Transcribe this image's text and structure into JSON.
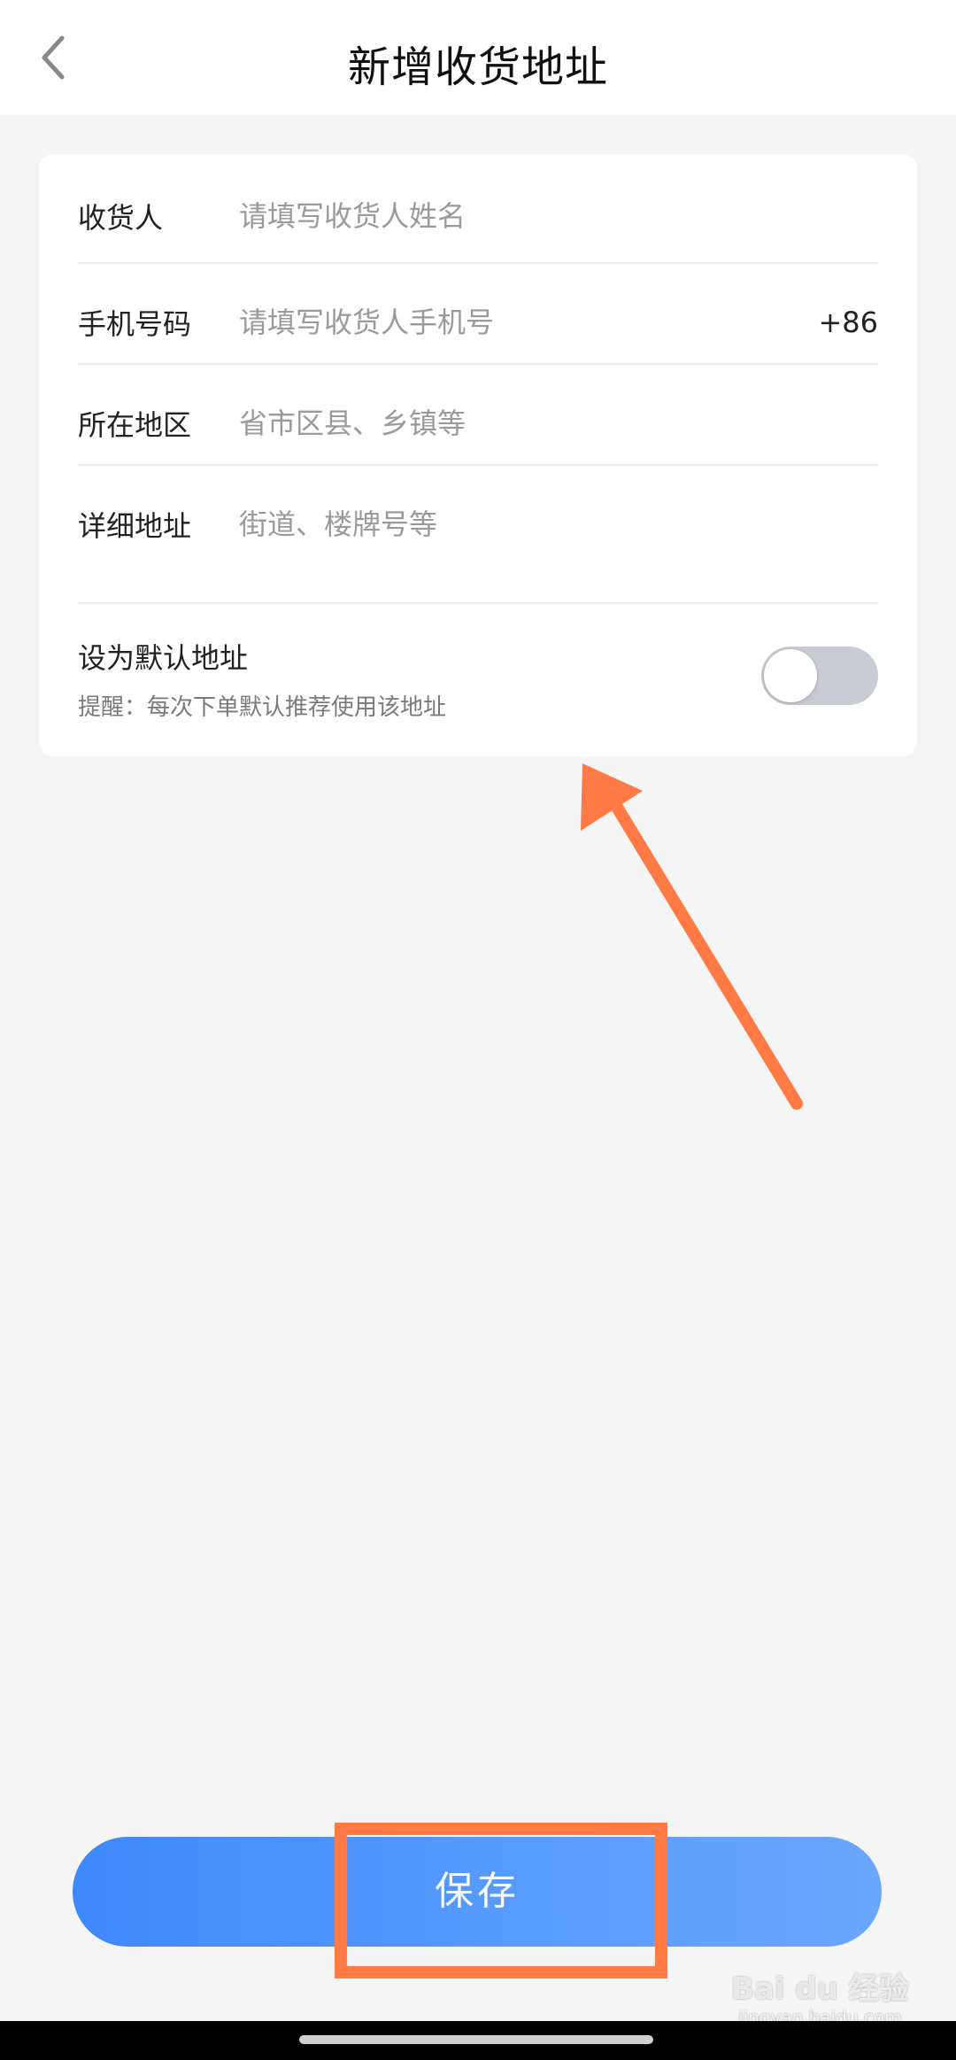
{
  "header": {
    "title": "新增收货地址"
  },
  "form": {
    "recipient": {
      "label": "收货人",
      "placeholder": "请填写收货人姓名",
      "value": ""
    },
    "phone": {
      "label": "手机号码",
      "placeholder": "请填写收货人手机号",
      "value": "",
      "country_code": "+86"
    },
    "region": {
      "label": "所在地区",
      "placeholder": "省市区县、乡镇等",
      "value": ""
    },
    "detail": {
      "label": "详细地址",
      "placeholder": "街道、楼牌号等",
      "value": ""
    },
    "default_address": {
      "title": "设为默认地址",
      "hint": "提醒：每次下单默认推荐使用该地址",
      "enabled": false
    }
  },
  "footer": {
    "save_label": "保存"
  },
  "watermark": {
    "text": "Bai du 经验",
    "url": "jingyan.baidu.com"
  },
  "colors": {
    "accent": "#4a90fc",
    "annotation": "#ff7a45",
    "toggle_off": "#c9ccd3"
  },
  "icons": {
    "back": "chevron-left-icon",
    "arrow": "arrow-annotation-icon"
  }
}
